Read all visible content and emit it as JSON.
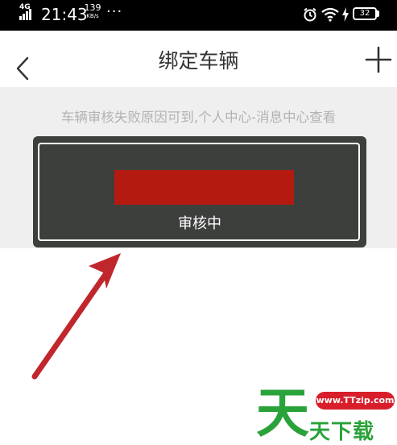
{
  "status_bar": {
    "network": "4G",
    "time": "21:43",
    "speed_value": "139",
    "speed_unit": "KB/s",
    "more": "···",
    "battery": "32",
    "icons": [
      "signal-icon",
      "alarm-icon",
      "wifi-icon",
      "charging-icon",
      "battery-icon"
    ]
  },
  "header": {
    "title": "绑定车辆",
    "back_icon": "chevron-left-icon",
    "add_icon": "plus-icon"
  },
  "notice": {
    "text": "车辆审核失败原因可到,个人中心-消息中心查看"
  },
  "vehicle_card": {
    "status": "审核中"
  },
  "watermark": {
    "url": "www.TTzip.com",
    "big_char": "天",
    "small_text": "天下载"
  },
  "colors": {
    "status_bar_bg": "#000000",
    "notice_bg": "#efefef",
    "card_bg": "#3d3f3d",
    "redaction": "#b51a10",
    "arrow": "#c0272d",
    "watermark_green": "#2aa23a",
    "watermark_red": "#d81e2b"
  }
}
